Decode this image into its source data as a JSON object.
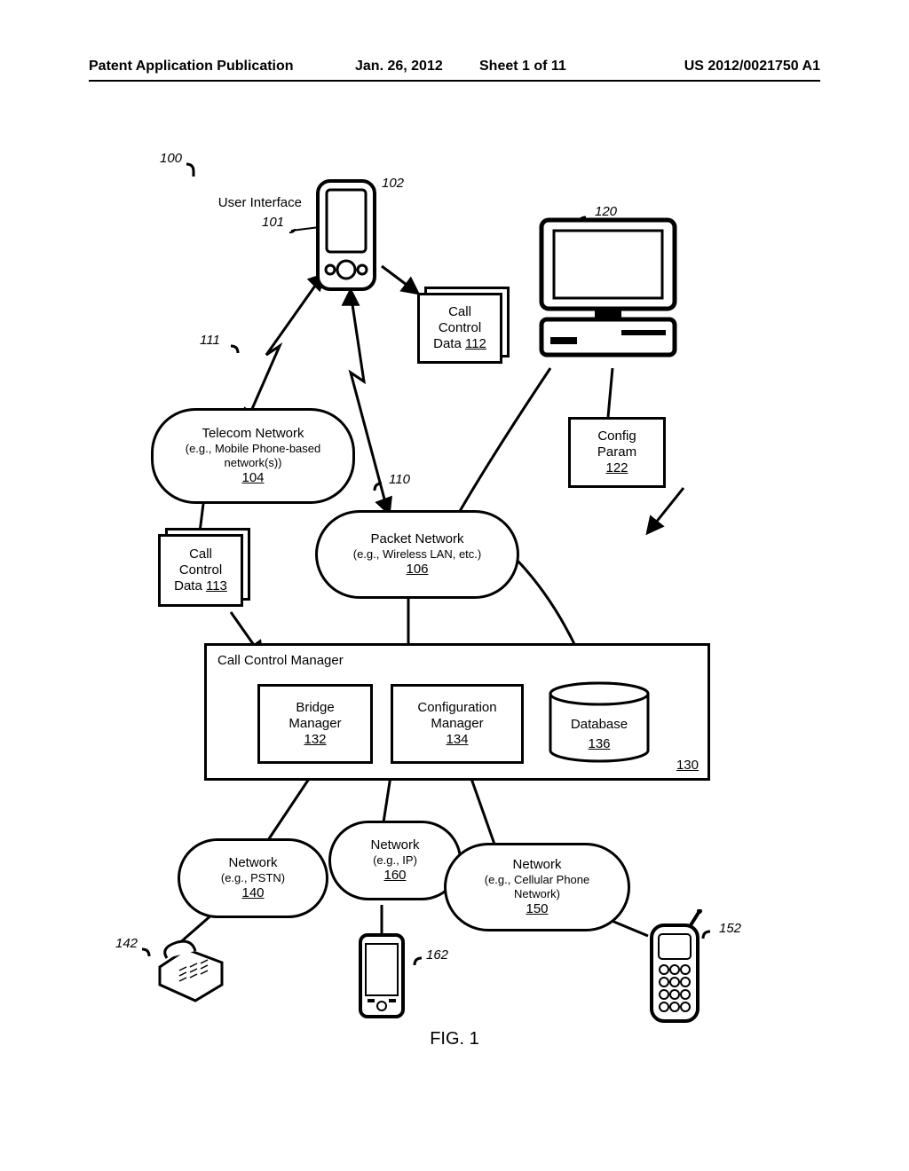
{
  "header": {
    "left": "Patent Application Publication",
    "date": "Jan. 26, 2012",
    "sheet": "Sheet 1 of 11",
    "pubno": "US 2012/0021750 A1"
  },
  "figure_caption": "FIG. 1",
  "refs": {
    "system": "100",
    "ui": "101",
    "pda": "102",
    "telecom_net": "104",
    "packet_net": "106",
    "link110": "110",
    "link111": "111",
    "ccd112": "112",
    "ccd113": "113",
    "pc": "120",
    "configparam": "122",
    "ccm": "130",
    "bridge": "132",
    "configmgr": "134",
    "database": "136",
    "net_pstn": "140",
    "phone142": "142",
    "net_cell": "150",
    "phone152": "152",
    "net_ip": "160",
    "phone162": "162"
  },
  "labels": {
    "user_interface": "User Interface",
    "call_control_data": "Call Control Data",
    "telecom_network_l1": "Telecom Network",
    "telecom_network_l2": "(e.g., Mobile Phone-based",
    "telecom_network_l3": "network(s))",
    "packet_network_l1": "Packet Network",
    "packet_network_l2": "(e.g., Wireless LAN, etc.)",
    "config_param": "Config Param",
    "call_control_manager": "Call Control Manager",
    "bridge_manager": "Bridge Manager",
    "configuration_manager": "Configuration Manager",
    "database": "Database",
    "network": "Network",
    "net_pstn_sub": "(e.g., PSTN)",
    "net_ip_sub": "(e.g., IP)",
    "net_cell_sub_l1": "(e.g., Cellular Phone",
    "net_cell_sub_l2": "Network)"
  }
}
